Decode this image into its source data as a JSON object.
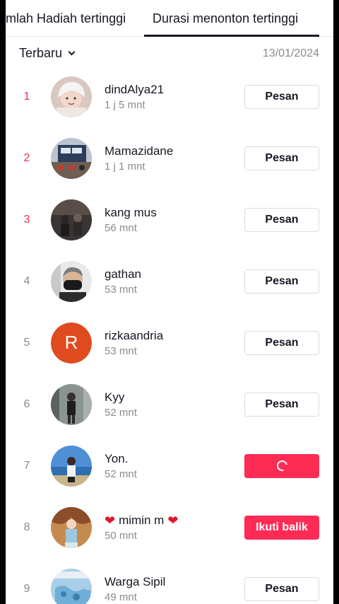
{
  "tabs": {
    "left": "mlah Hadiah tertinggi",
    "right": "Durasi menonton tertinggi"
  },
  "filter": {
    "label": "Terbaru",
    "date": "13/01/2024"
  },
  "rows": [
    {
      "rank": "1",
      "name": "dindAlya21",
      "duration": "1 j 5 mnt",
      "button": "Pesan"
    },
    {
      "rank": "2",
      "name": "Mamazidane",
      "duration": "1 j 1 mnt",
      "button": "Pesan"
    },
    {
      "rank": "3",
      "name": "kang mus",
      "duration": "56 mnt",
      "button": "Pesan"
    },
    {
      "rank": "4",
      "name": "gathan",
      "duration": "53 mnt",
      "button": "Pesan"
    },
    {
      "rank": "5",
      "name": "rizkaandria",
      "duration": "53 mnt",
      "button": "Pesan",
      "avatar_letter": "R"
    },
    {
      "rank": "6",
      "name": "Kyy",
      "duration": "52 mnt",
      "button": "Pesan"
    },
    {
      "rank": "7",
      "name": "Yon.",
      "duration": "52 mnt",
      "button": ""
    },
    {
      "rank": "8",
      "name": "mimin m",
      "duration": "50 mnt",
      "button": "Ikuti balik"
    },
    {
      "rank": "9",
      "name": "Warga Sipil",
      "duration": "49 mnt",
      "button": "Pesan"
    }
  ],
  "colors": {
    "accent": "#fe2c55",
    "top_rank": "#e8334a"
  }
}
